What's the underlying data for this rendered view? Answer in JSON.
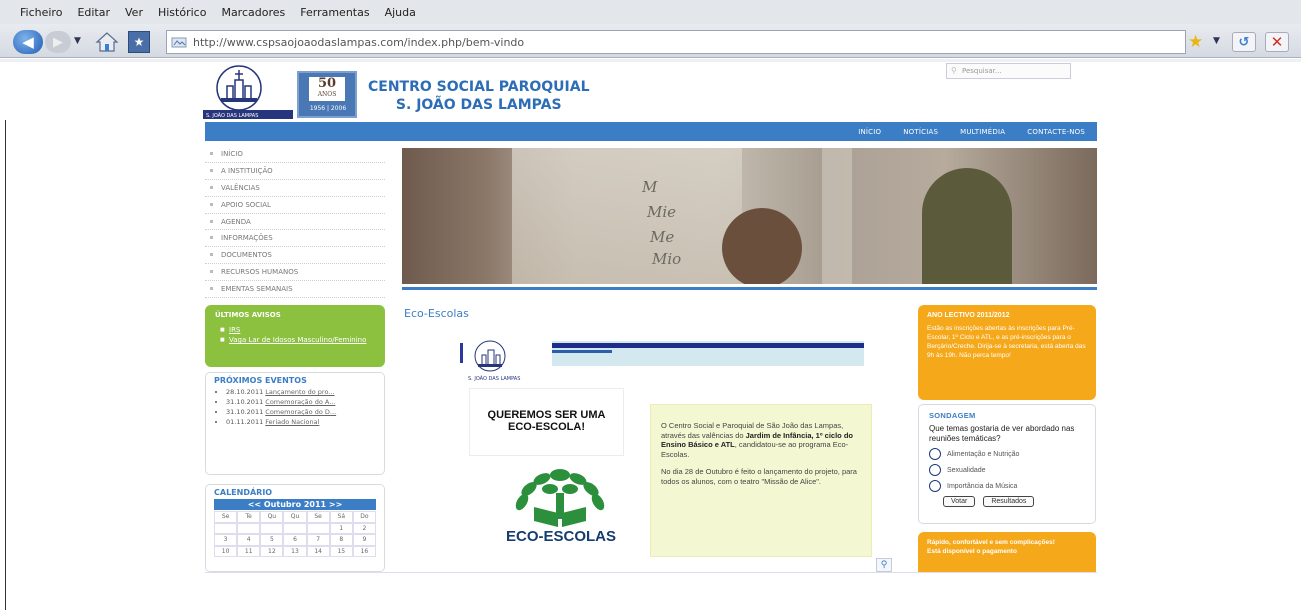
{
  "browser": {
    "menu": [
      "Ficheiro",
      "Editar",
      "Ver",
      "Histórico",
      "Marcadores",
      "Ferramentas",
      "Ajuda"
    ],
    "url": "http://www.cspsaojoaodaslampas.com/index.php/bem-vindo",
    "back_icon": "back-arrow-icon",
    "forward_icon": "forward-arrow-icon"
  },
  "header": {
    "title_line1": "CENTRO SOCIAL PAROQUIAL",
    "title_line2": "S. JOÃO DAS LAMPAS",
    "badge_number": "50",
    "badge_word": "ANOS",
    "badge_years": "1956 | 2006",
    "search_placeholder": "Pesquisar..."
  },
  "topnav": [
    "INÍCIO",
    "NOTÍCIAS",
    "MULTIMÉDIA",
    "CONTACTE-NOS"
  ],
  "sidenav": [
    "INÍCIO",
    "A INSTITUIÇÃO",
    "VALÊNCIAS",
    "APOIO SOCIAL",
    "AGENDA",
    "INFORMAÇÕES",
    "DOCUMENTOS",
    "RECURSOS HUMANOS",
    "EMENTAS SEMANAIS"
  ],
  "avisos": {
    "title": "ÚLTIMOS AVISOS",
    "items": [
      "IRS",
      "Vaga Lar de Idosos Masculino/Feminino"
    ]
  },
  "eventos": {
    "title": "PRÓXIMOS EVENTOS",
    "items": [
      {
        "date": "28.10.2011",
        "text": "Lançamento do pro..."
      },
      {
        "date": "31.10.2011",
        "text": "Comemoração do A..."
      },
      {
        "date": "31.10.2011",
        "text": "Comemoração do D..."
      },
      {
        "date": "01.11.2011",
        "text": "Feriado Nacional"
      }
    ]
  },
  "calendario": {
    "title": "CALENDÁRIO",
    "month": "<<  Outubro 2011  >>",
    "weekdays": [
      "Se",
      "Te",
      "Qu",
      "Qu",
      "Se",
      "Sá",
      "Do"
    ],
    "days": [
      "",
      "",
      "",
      "",
      "",
      "1",
      "2",
      "3",
      "4",
      "5",
      "6",
      "7",
      "8",
      "9",
      "10",
      "11",
      "12",
      "13",
      "14",
      "15",
      "16"
    ]
  },
  "article": {
    "section_title": "Eco-Escolas",
    "quer_line1": "QUEREMOS SER UMA",
    "quer_line2": "ECO-ESCOLA!",
    "eco_label": "ECO-ESCOLAS",
    "para1_start": "O Centro Social e Paroquial de São João das Lampas, através das valências do ",
    "para1_bold": "Jardim de Infância, 1º ciclo do Ensino Básico e ATL",
    "para1_end": ", candidatou-se ao programa Eco-Escolas.",
    "para2": "No dia 28 de Outubro é feito o lançamento do projeto, para todos os alunos, com o teatro \"Missão de Alice\"."
  },
  "ano_letivo": {
    "title": "ANO LECTIVO 2011/2012",
    "text": "Estão as inscrições abertas às inscrições para Pré-Escolar, 1º Ciclo e ATL, e as pré-inscrições para o Berçário/Creche. Dirija-se à secretaria, está aberta das 9h às 19h. Não perca tempo!"
  },
  "sondagem": {
    "title": "SONDAGEM",
    "question": "Que temas gostaria de ver abordado nas reuniões temáticas?",
    "options": [
      "Alimentação e Nutrição",
      "Sexualidade",
      "Importância da Música"
    ],
    "vote_label": "Votar",
    "results_label": "Resultados"
  },
  "contrib": {
    "line1": "Rápido, confortável e sem complicações!",
    "line2": "Está disponível o pagamento"
  },
  "colors": {
    "nav_blue": "#3b7ec6",
    "green": "#8cc13f",
    "orange": "#f6a81b"
  }
}
